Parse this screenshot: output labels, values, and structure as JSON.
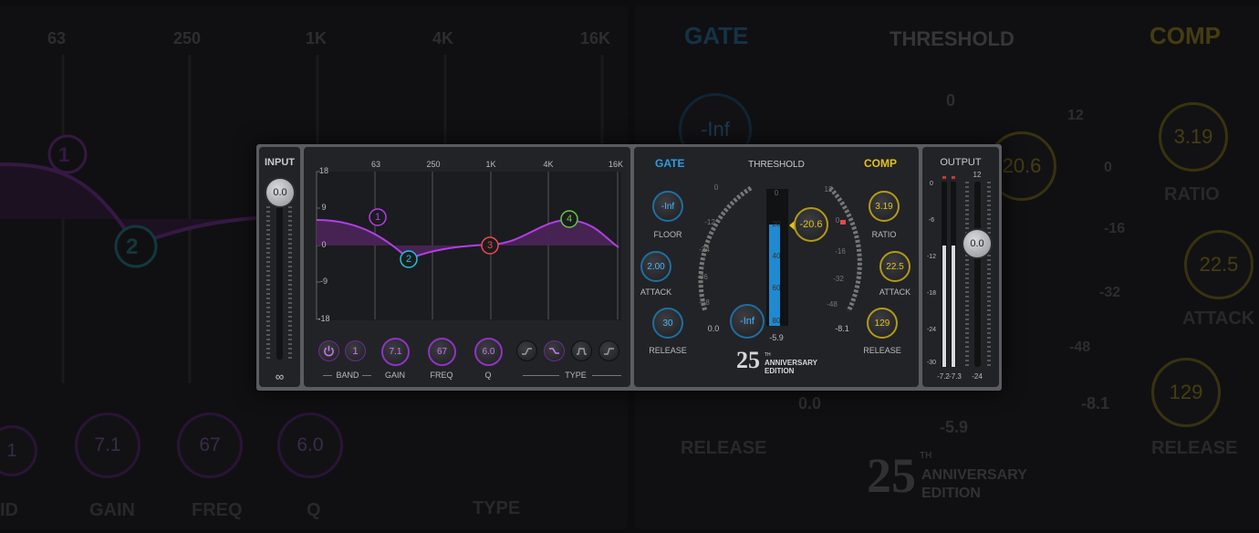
{
  "eq": {
    "freq_labels": [
      "63",
      "250",
      "1K",
      "4K",
      "16K"
    ],
    "db_labels": [
      "18",
      "9",
      "0",
      "-9",
      "-18"
    ],
    "bands": [
      "1",
      "2",
      "3",
      "4"
    ],
    "band_label": "BAND",
    "band_value": "1",
    "gain_label": "GAIN",
    "gain_value": "7.1",
    "freq_label": "FREQ",
    "freq_value": "67",
    "q_label": "Q",
    "q_value": "6.0",
    "type_label": "TYPE",
    "type_icons": [
      "low-shelf-icon",
      "bell-icon",
      "band-pass-icon",
      "high-shelf-icon"
    ],
    "accent": "#b13fe6"
  },
  "input": {
    "label": "INPUT",
    "value": "0.0",
    "bottom": "∞"
  },
  "gate": {
    "title": "GATE",
    "accent": "#2b9fe0",
    "floor_value": "-Inf",
    "floor_label": "FLOOR",
    "attack_value": "2.00",
    "attack_label": "ATTACK",
    "release_value": "30",
    "release_label": "RELEASE",
    "threshold_value": "-Inf",
    "meter_left": "0.0",
    "scale": [
      "0",
      "-12",
      "-24",
      "-36",
      "-48"
    ]
  },
  "threshold": {
    "title": "THRESHOLD",
    "scale": [
      "0",
      "20",
      "40",
      "60",
      "80"
    ],
    "bottom": "-5.9",
    "level": 0.74
  },
  "comp": {
    "title": "COMP",
    "accent": "#e3c21c",
    "threshold_value": "-20.6",
    "ratio_value": "3.19",
    "ratio_label": "RATIO",
    "attack_value": "22.5",
    "attack_label": "ATTACK",
    "release_value": "129",
    "release_label": "RELEASE",
    "meter_right": "-8.1",
    "scale": [
      "12",
      "0",
      "-16",
      "-32",
      "-48"
    ]
  },
  "logo": {
    "number": "25",
    "sup": "TH",
    "line1": "ANNIVERSARY",
    "line2": "EDITION"
  },
  "output": {
    "label": "OUTPUT",
    "top": "12",
    "scale": [
      "0",
      "-6",
      "-12",
      "-18",
      "-24",
      "-30"
    ],
    "value": "0.0",
    "readout_l": "-7.2",
    "readout_r": "-7.3",
    "readout_fader": "-24"
  },
  "background": {
    "gate": "GATE",
    "threshold": "THRESHOLD",
    "comp": "COMP",
    "freqs": [
      "63",
      "250",
      "1K",
      "4K",
      "16K"
    ],
    "knobs": [
      "1",
      "7.1",
      "67",
      "6.0"
    ],
    "labels": [
      "GAIN",
      "FREQ",
      "Q",
      "TYPE"
    ],
    "band_cut": "ID",
    "right_knobs": [
      "-Inf",
      "3.19",
      "20.6",
      "22.5",
      "129",
      "0.0",
      "-8.1",
      "-5.9",
      "0"
    ],
    "right_labels": [
      "RATIO",
      "ATTACK",
      "RELEASE",
      "RELEASE"
    ],
    "scale": [
      "12",
      "0",
      "-16",
      "-32",
      "-48"
    ],
    "logo_line1": "ANNIVERSARY",
    "logo_line2": "EDITION",
    "logo_number": "25",
    "logo_sup": "TH"
  }
}
